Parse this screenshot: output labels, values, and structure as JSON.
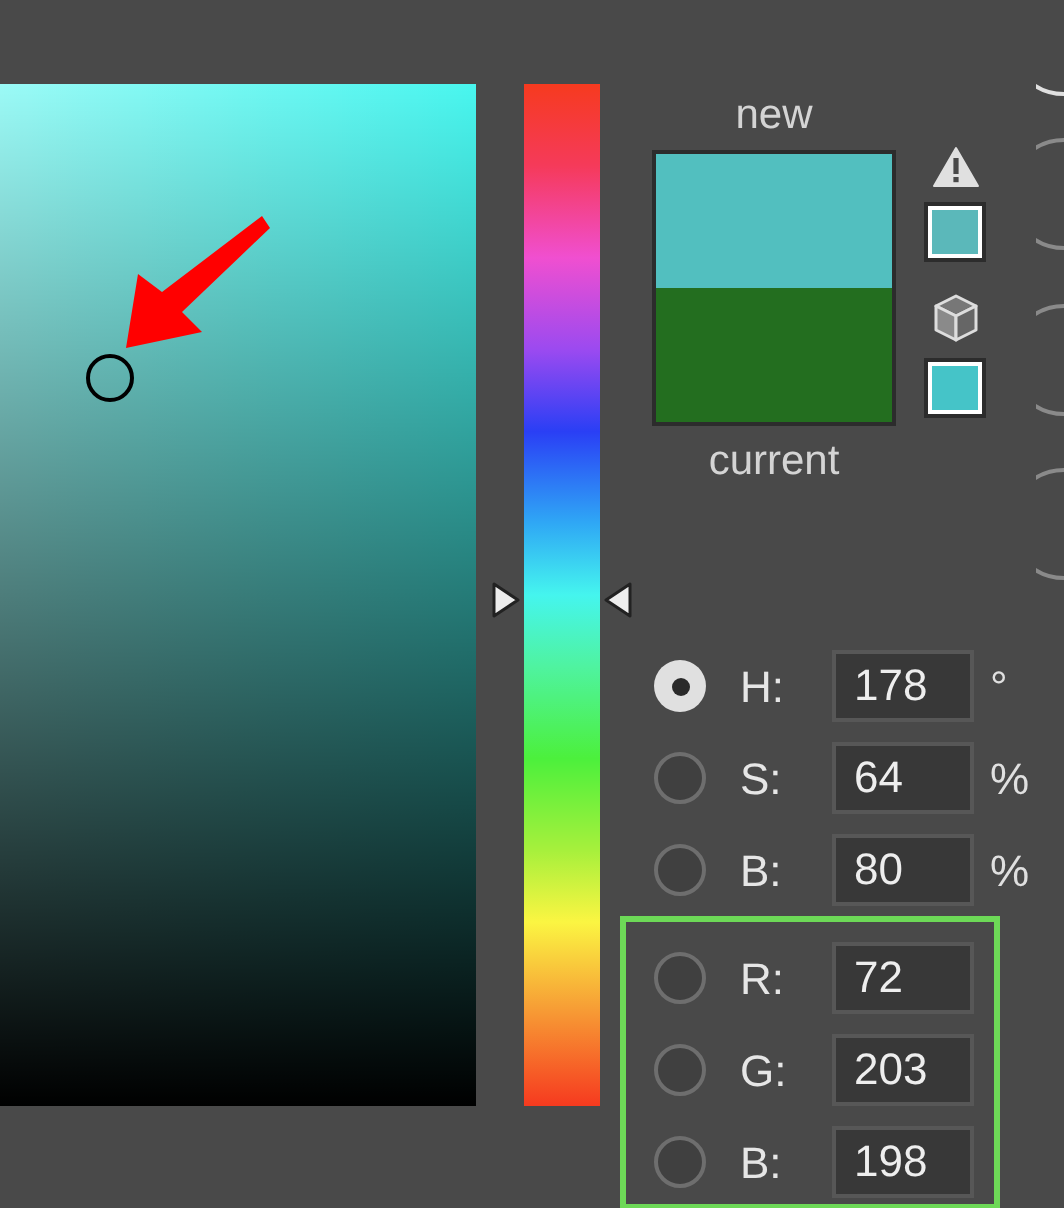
{
  "hue_slider": {
    "level": 0.495
  },
  "preview": {
    "new_label": "new",
    "current_label": "current",
    "swatches": [
      {
        "color": "#52bfbf"
      },
      {
        "color": "#236e1f"
      }
    ]
  },
  "gamut_warning": {
    "color": "#5bb8ba"
  },
  "web_safe": {
    "color": "#45c4c8"
  },
  "hsb_fields": [
    {
      "label": "H:",
      "value": "178",
      "unit": "°",
      "selected": true
    },
    {
      "label": "S:",
      "value": "64",
      "unit": "%",
      "selected": false
    },
    {
      "label": "B:",
      "value": "80",
      "unit": "%",
      "selected": false
    }
  ],
  "rgb_fields": {
    "outlined": true,
    "items": [
      {
        "label": "R:",
        "value": "72",
        "selected": false
      },
      {
        "label": "G:",
        "value": "203",
        "selected": false
      },
      {
        "label": "B:",
        "value": "198",
        "selected": false
      }
    ]
  }
}
